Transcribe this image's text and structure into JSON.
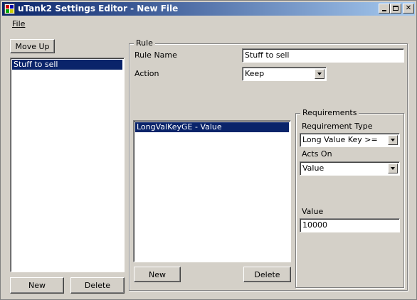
{
  "window": {
    "title": "uTank2 Settings Editor - New File"
  },
  "menu": {
    "file_label": "File"
  },
  "left": {
    "move_up_label": "Move Up",
    "rules": [
      "Stuff to sell"
    ],
    "new_label": "New",
    "delete_label": "Delete"
  },
  "rule": {
    "group_label": "Rule",
    "name_label": "Rule Name",
    "name_value": "Stuff to sell",
    "action_label": "Action",
    "action_value": "Keep",
    "requirements_list": [
      "LongValKeyGE - Value"
    ],
    "new_label": "New",
    "delete_label": "Delete"
  },
  "requirements": {
    "group_label": "Requirements",
    "type_label": "Requirement Type",
    "type_value": "Long Value Key >=",
    "acts_on_label": "Acts On",
    "acts_on_value": "Value",
    "value_label": "Value",
    "value_value": "10000"
  },
  "colors": {
    "title_start": "#0a246a",
    "title_end": "#a6caf0",
    "selection": "#0a246a",
    "face": "#d4d0c8"
  }
}
